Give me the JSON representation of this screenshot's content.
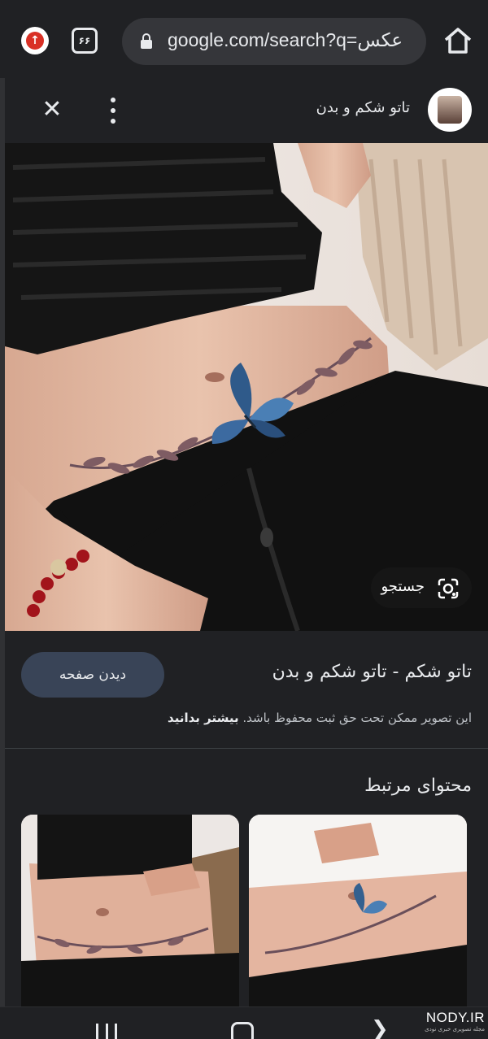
{
  "browser": {
    "url": "google.com/search?q=عکس",
    "tab_count": "۶۶",
    "icons": [
      "update-arrow-icon",
      "tabs-counter-icon",
      "lock-icon",
      "home-icon"
    ]
  },
  "panel": {
    "site_name": "تاتو شکم و بدن",
    "lens_label": "جستجو",
    "visit_button": "دیدن صفحه",
    "result_title": "تاتو شکم - تاتو شکم و بدن",
    "copyright_text": "این تصویر ممکن تحت حق ثبت محفوظ باشد.",
    "copyright_link": "بیشتر بدانید"
  },
  "related": {
    "title": "محتوای مرتبط"
  },
  "watermark": {
    "main": "NODY.IR",
    "sub": "مجله تصویری خبری نودی"
  },
  "colors": {
    "background": "#202124",
    "url_pill": "#35363a",
    "visit_button": "#394457",
    "update_badge": "#d93025"
  }
}
